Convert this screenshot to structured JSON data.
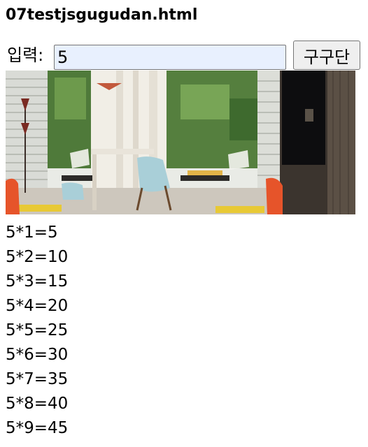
{
  "page": {
    "title": "07testjsgugudan.html"
  },
  "form": {
    "label": "입력:",
    "input_value": "5",
    "button_label": "구구단"
  },
  "results": [
    "5*1=5",
    "5*2=10",
    "5*3=15",
    "5*4=20",
    "5*5=25",
    "5*6=30",
    "5*7=35",
    "5*8=40",
    "5*9=45"
  ]
}
